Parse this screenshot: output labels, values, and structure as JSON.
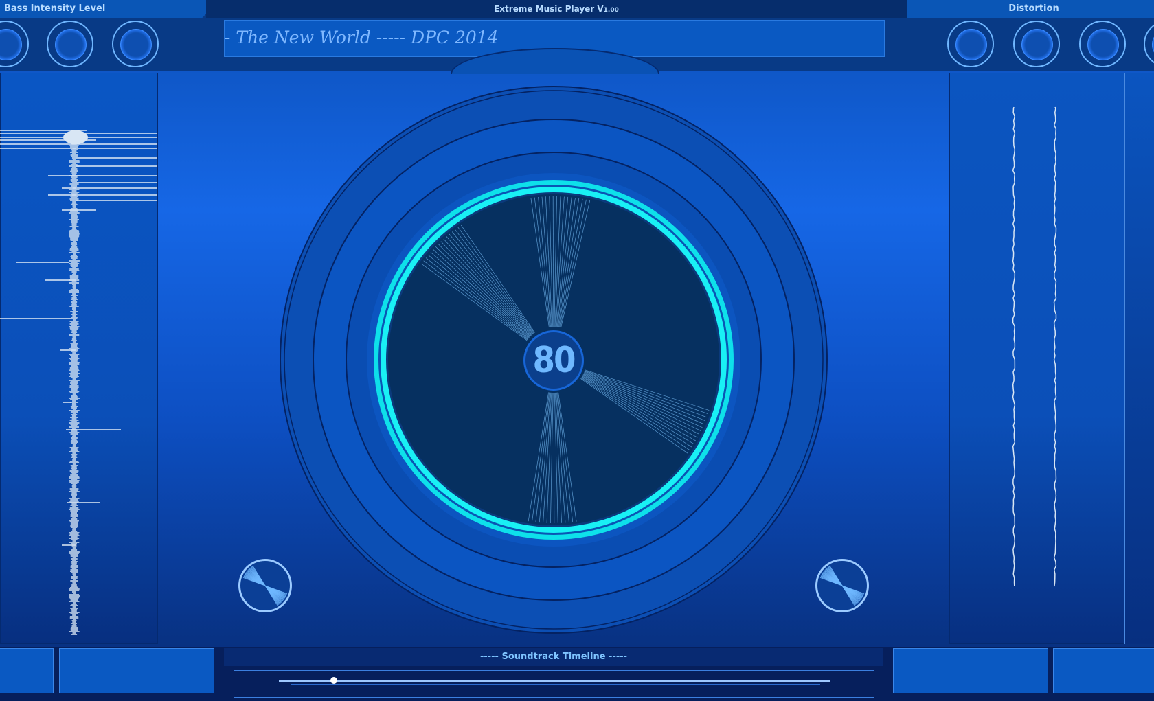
{
  "header": {
    "left_tab": "Bass Intensity Level",
    "title": "Extreme Music Player V",
    "version": "1.00",
    "right_tab": "Distortion",
    "now_playing": "- The New World ----- DPC 2014"
  },
  "center": {
    "bpm": "80"
  },
  "timeline": {
    "label": "----- Soundtrack Timeline -----",
    "progress": 0.1
  },
  "icons": [
    "knob-icon",
    "mini-dial-icon",
    "waveform-icon",
    "distortion-meter-icon"
  ],
  "colors": {
    "accent": "#18e8ee",
    "panel": "#0a59c2",
    "background": "#1667e6",
    "dark": "#062d6c"
  }
}
